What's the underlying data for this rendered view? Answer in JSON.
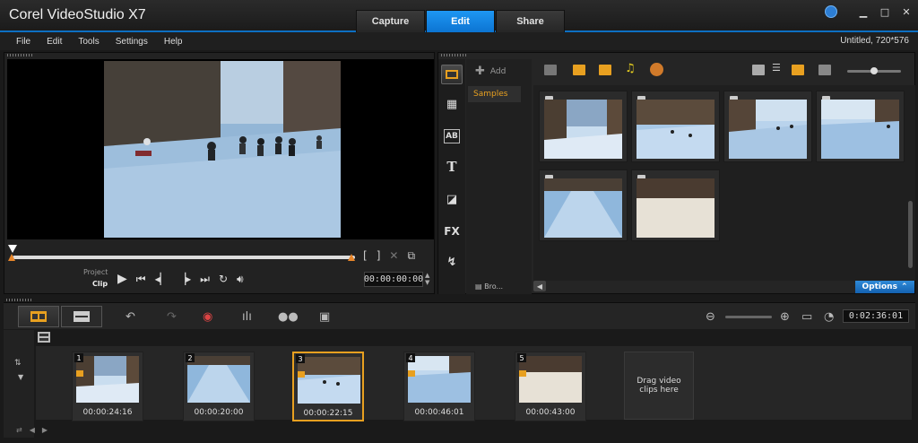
{
  "app": {
    "title": "Corel VideoStudio X7"
  },
  "tabs": [
    {
      "label": "Capture",
      "active": false
    },
    {
      "label": "Edit",
      "active": true
    },
    {
      "label": "Share",
      "active": false
    }
  ],
  "menu": {
    "file": "File",
    "edit": "Edit",
    "tools": "Tools",
    "settings": "Settings",
    "help": "Help"
  },
  "project_info": "Untitled, 720*576",
  "player": {
    "project_label": "Project",
    "clip_label": "Clip",
    "timecode": "00:00:00:00",
    "mark_in": "[",
    "mark_out": "]"
  },
  "library": {
    "add_label": "Add",
    "folder": "Samples",
    "browse_label": "Bro...",
    "options_label": "Options",
    "side_fx": "FX",
    "side_title": "T",
    "side_ab": "AB"
  },
  "timeline": {
    "duration": "0:02:36:01",
    "clips": [
      {
        "number": "1",
        "duration": "00:00:24:16"
      },
      {
        "number": "2",
        "duration": "00:00:20:00"
      },
      {
        "number": "3",
        "duration": "00:00:22:15"
      },
      {
        "number": "4",
        "duration": "00:00:46:01"
      },
      {
        "number": "5",
        "duration": "00:00:43:00"
      }
    ],
    "drag_hint": "Drag video clips here"
  },
  "colors": {
    "accent": "#0c74d2",
    "highlight": "#e8a020",
    "background": "#1a1a1a"
  }
}
